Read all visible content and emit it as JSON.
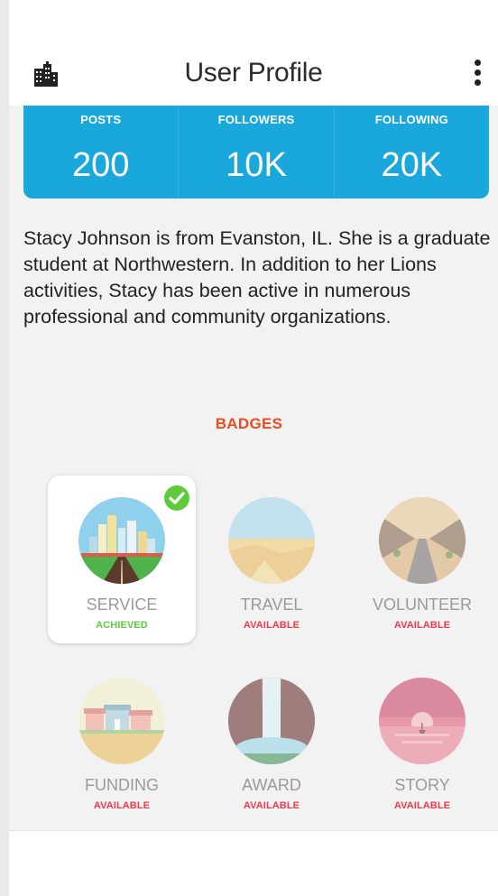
{
  "header": {
    "title": "User Profile",
    "building_icon": "building-icon",
    "menu_icon": "kebab-menu-icon"
  },
  "stats": [
    {
      "label": "POSTS",
      "value": "200"
    },
    {
      "label": "FOLLOWERS",
      "value": "10K"
    },
    {
      "label": "FOLLOWING",
      "value": "20K"
    }
  ],
  "bio": "Stacy Johnson is from Evanston, IL. She is a graduate student at Northwestern. In addition to her Lions activities, Stacy has been active in numerous professional and community organizations.",
  "badges_title": "BADGES",
  "badges": [
    {
      "name": "SERVICE",
      "status": "ACHIEVED"
    },
    {
      "name": "TRAVEL",
      "status": "AVAILABLE"
    },
    {
      "name": "VOLUNTEER",
      "status": "AVAILABLE"
    },
    {
      "name": "FUNDING",
      "status": "AVAILABLE"
    },
    {
      "name": "AWARD",
      "status": "AVAILABLE"
    },
    {
      "name": "STORY",
      "status": "AVAILABLE"
    }
  ],
  "colors": {
    "accent_blue": "#1aa7dc",
    "badges_title": "#ec4a20",
    "achieved": "#5fca3c",
    "available": "#ec3b4f"
  }
}
